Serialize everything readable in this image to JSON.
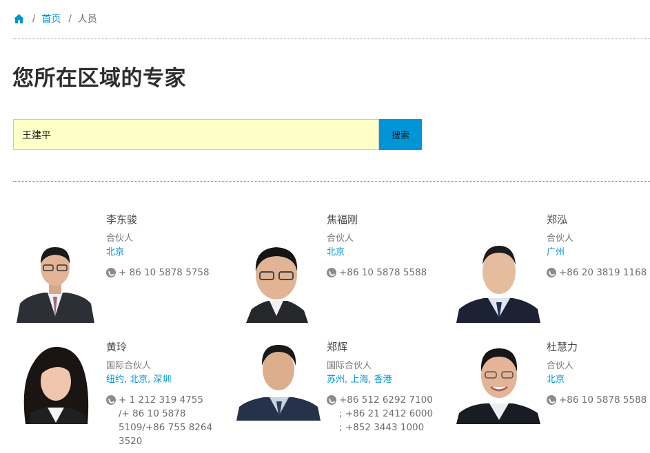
{
  "breadcrumb": {
    "home_icon": "home-icon",
    "separator": "/",
    "home": "首页",
    "current": "人员"
  },
  "page": {
    "title": "您所在区域的专家"
  },
  "search": {
    "value": "王建平",
    "button": "搜索"
  },
  "colors": {
    "accent": "#0095d6",
    "input_bg": "#ffffc8"
  },
  "people": [
    {
      "name": "李东骏",
      "title": "合伙人",
      "offices": "北京",
      "phone": "+ 86 10 5878 5758"
    },
    {
      "name": "焦福刚",
      "title": "合伙人",
      "offices": "北京",
      "phone": "+86 10 5878 5588"
    },
    {
      "name": "郑泓",
      "title": "合伙人",
      "offices": "广州",
      "phone": "+86 20 3819 1168"
    },
    {
      "name": "黄玲",
      "title": "国际合伙人",
      "offices": "纽约, 北京, 深圳",
      "phone": "+ 1 212 319 4755 /+ 86 10 5878 5109/+86 755 8264 3520"
    },
    {
      "name": "郑辉",
      "title": "国际合伙人",
      "offices": "苏州, 上海, 香港",
      "phone": "+86 512 6292 7100 ; +86 21 2412 6000 ; +852 3443 1000"
    },
    {
      "name": "杜慧力",
      "title": "合伙人",
      "offices": "北京",
      "phone": "+86 10 5878 5588"
    }
  ]
}
